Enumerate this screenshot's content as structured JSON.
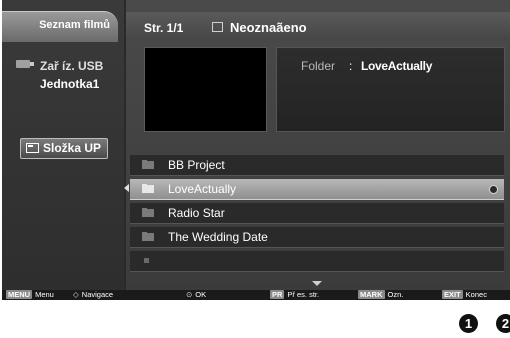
{
  "sidebar": {
    "title": "Seznam filmů",
    "device_line1": "Zař íz. USB",
    "device_line2": "Jednotka1",
    "up_button": "Složka UP"
  },
  "topbar": {
    "page": "Str. 1/1",
    "unmarked": "Neoznaãeno"
  },
  "info": {
    "label": "Folder",
    "colon": ":",
    "value": "LoveActually"
  },
  "files": [
    {
      "name": "BB Project",
      "selected": false
    },
    {
      "name": "LoveActually",
      "selected": true
    },
    {
      "name": "Radio Star",
      "selected": false
    },
    {
      "name": "The Wedding Date",
      "selected": false
    },
    {
      "name": "",
      "selected": false
    }
  ],
  "statusbar": {
    "menu_key": "MENU",
    "menu_label": "Menu",
    "nav_glyph": "◇",
    "nav_label": "Navigace",
    "ok_glyph": "⊙",
    "ok_label": "OK",
    "page_key": "PR",
    "page_label": "Př es. str.",
    "mark_key": "MARK",
    "mark_label": "Ozn.",
    "exit_key": "EXIT",
    "exit_label": "Konec"
  },
  "callouts": [
    "1",
    "2"
  ],
  "colors": {
    "selected_row": "#a8a8a8",
    "background": "#2a2a2a"
  }
}
